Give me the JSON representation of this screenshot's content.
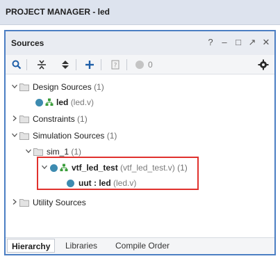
{
  "header": {
    "title": "PROJECT MANAGER - led"
  },
  "panel": {
    "title": "Sources",
    "controls": {
      "help": "?",
      "minimize": "–",
      "maximize": "□",
      "float": "↗",
      "close": "✕"
    }
  },
  "toolbar": {
    "buttons": [
      "search",
      "collapse-all",
      "expand-all",
      "add",
      "properties",
      "status"
    ],
    "status_count": "0"
  },
  "tree": {
    "design_sources": {
      "label": "Design Sources",
      "count": "(1)"
    },
    "led": {
      "name": "led",
      "file": "(led.v)"
    },
    "constraints": {
      "label": "Constraints",
      "count": "(1)"
    },
    "simulation_sources": {
      "label": "Simulation Sources",
      "count": "(1)"
    },
    "sim_1": {
      "label": "sim_1",
      "count": "(1)"
    },
    "vtf_led_test": {
      "name": "vtf_led_test",
      "file": "(vtf_led_test.v)",
      "count": "(1)"
    },
    "uut": {
      "name": "uut : led",
      "file": "(led.v)"
    },
    "utility_sources": {
      "label": "Utility Sources"
    }
  },
  "tabs": [
    {
      "label": "Hierarchy",
      "active": true
    },
    {
      "label": "Libraries",
      "active": false
    },
    {
      "label": "Compile Order",
      "active": false
    }
  ],
  "colors": {
    "accent_border": "#4b7ec3",
    "highlight": "#e0312d",
    "node_dot": "#3d8bb0"
  }
}
